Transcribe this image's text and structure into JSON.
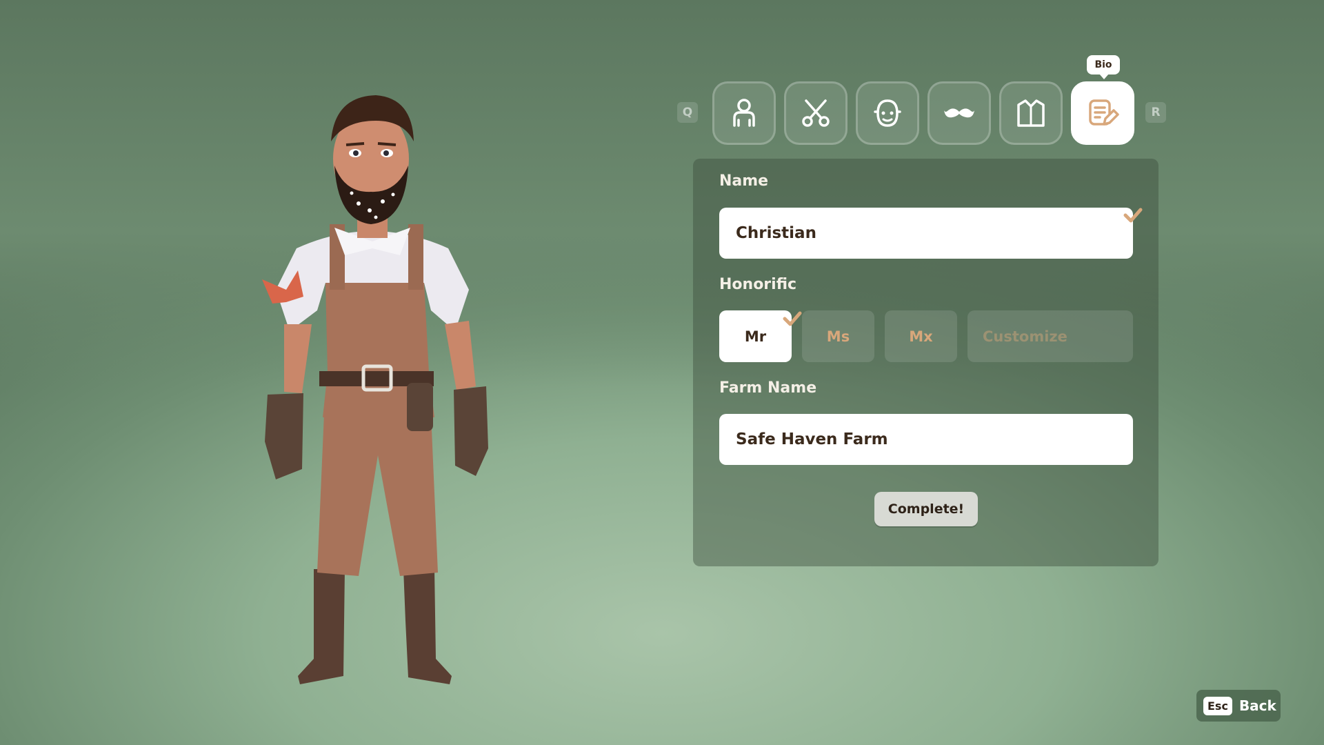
{
  "tabs": {
    "prev_key": "Q",
    "next_key": "R",
    "tooltip": "Bio",
    "items": [
      {
        "icon": "body-icon"
      },
      {
        "icon": "scissors-icon"
      },
      {
        "icon": "face-icon"
      },
      {
        "icon": "mustache-icon"
      },
      {
        "icon": "shirt-icon"
      },
      {
        "icon": "bio-icon",
        "active": true
      }
    ]
  },
  "form": {
    "name_label": "Name",
    "name_value": "Christian",
    "honorific_label": "Honorific",
    "honorifics": [
      "Mr",
      "Ms",
      "Mx"
    ],
    "honorific_selected": "Mr",
    "customize_placeholder": "Customize",
    "farm_label": "Farm Name",
    "farm_value": "Safe Haven Farm",
    "complete_label": "Complete!"
  },
  "back": {
    "key": "Esc",
    "label": "Back"
  },
  "colors": {
    "accent": "#d8a77b",
    "panel": "#3a4a3a",
    "text_dark": "#3b2a1c"
  }
}
